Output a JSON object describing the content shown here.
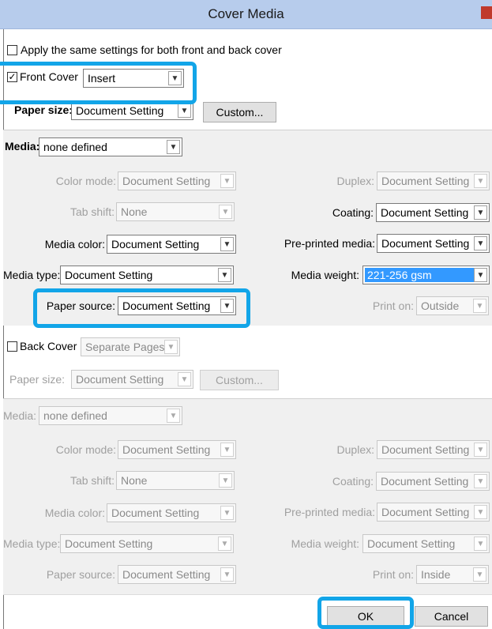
{
  "window": {
    "title": "Cover Media"
  },
  "apply_same": {
    "label": "Apply the same settings for both front and back cover",
    "checked": false
  },
  "front": {
    "checkbox_label": "Front Cover",
    "checked": true,
    "mode": "Insert",
    "paper_size_label": "Paper size:",
    "paper_size": "Document Setting",
    "custom_label": "Custom...",
    "media_label": "Media:",
    "media": "none defined",
    "color_mode_label": "Color mode:",
    "color_mode": "Document Setting",
    "tab_shift_label": "Tab shift:",
    "tab_shift": "None",
    "media_color_label": "Media color:",
    "media_color": "Document Setting",
    "media_type_label": "Media type:",
    "media_type": "Document Setting",
    "paper_source_label": "Paper source:",
    "paper_source": "Document Setting",
    "duplex_label": "Duplex:",
    "duplex": "Document Setting",
    "coating_label": "Coating:",
    "coating": "Document Setting",
    "preprinted_label": "Pre-printed media:",
    "preprinted": "Document Setting",
    "media_weight_label": "Media weight:",
    "media_weight": "221-256 gsm",
    "print_on_label": "Print on:",
    "print_on": "Outside"
  },
  "back": {
    "checkbox_label": "Back Cover",
    "checked": false,
    "mode": "Separate Pages",
    "paper_size_label": "Paper size:",
    "paper_size": "Document Setting",
    "custom_label": "Custom...",
    "media_label": "Media:",
    "media": "none defined",
    "color_mode_label": "Color mode:",
    "color_mode": "Document Setting",
    "tab_shift_label": "Tab shift:",
    "tab_shift": "None",
    "media_color_label": "Media color:",
    "media_color": "Document Setting",
    "media_type_label": "Media type:",
    "media_type": "Document Setting",
    "paper_source_label": "Paper source:",
    "paper_source": "Document Setting",
    "duplex_label": "Duplex:",
    "duplex": "Document Setting",
    "coating_label": "Coating:",
    "coating": "Document Setting",
    "preprinted_label": "Pre-printed media:",
    "preprinted": "Document Setting",
    "media_weight_label": "Media weight:",
    "media_weight": "Document Setting",
    "print_on_label": "Print on:",
    "print_on": "Inside"
  },
  "buttons": {
    "ok": "OK",
    "cancel": "Cancel"
  },
  "icons": {
    "dropdown": "chevron-down-icon",
    "check": "checkmark-icon",
    "close": "close-icon"
  },
  "colors": {
    "titlebar": "#b7ccec",
    "highlight": "#12a5e8",
    "selection": "#3399ff",
    "panel": "#f0f0f0"
  }
}
